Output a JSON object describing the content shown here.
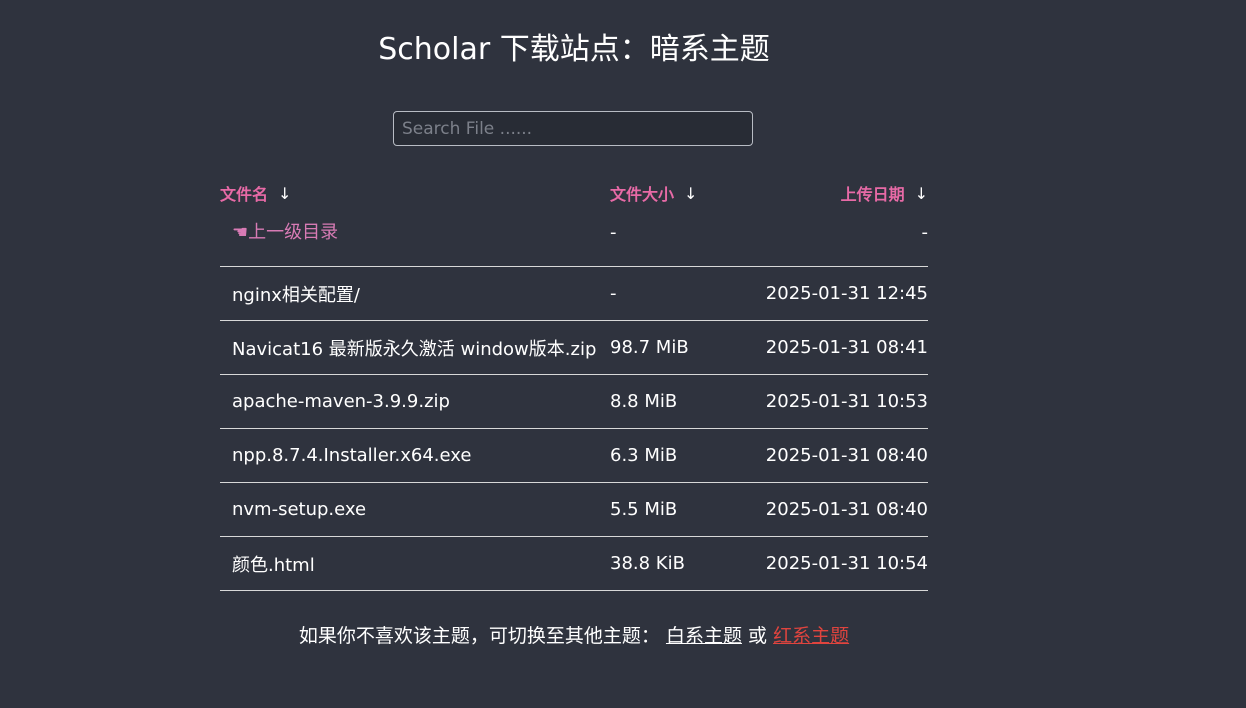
{
  "page": {
    "title": "Scholar 下载站点：暗系主题"
  },
  "search": {
    "placeholder": "Search File ......",
    "value": ""
  },
  "table": {
    "headers": {
      "name": "文件名",
      "size": "文件大小",
      "date": "上传日期",
      "sort_arrow": "↓"
    },
    "parent_row": {
      "name": "☚上一级目录",
      "size": "-",
      "date": "-"
    },
    "rows": [
      {
        "name": "nginx相关配置/",
        "size": "-",
        "date": "2025-01-31 12:45"
      },
      {
        "name": "Navicat16 最新版永久激活 window版本.zip",
        "size": "98.7 MiB",
        "date": "2025-01-31 08:41"
      },
      {
        "name": "apache-maven-3.9.9.zip",
        "size": "8.8 MiB",
        "date": "2025-01-31 10:53"
      },
      {
        "name": "npp.8.7.4.Installer.x64.exe",
        "size": "6.3 MiB",
        "date": "2025-01-31 08:40"
      },
      {
        "name": "nvm-setup.exe",
        "size": "5.5 MiB",
        "date": "2025-01-31 08:40"
      },
      {
        "name": "颜色.html",
        "size": "38.8 KiB",
        "date": "2025-01-31 10:54"
      }
    ]
  },
  "footer": {
    "text": "如果你不喜欢该主题，可切换至其他主题：",
    "white_theme_link": "白系主题",
    "or": "或",
    "red_theme_link": "红系主题"
  },
  "colors": {
    "background": "#2f333e",
    "accent_pink": "#e76aa6",
    "parent_link": "#d87bb5",
    "red_link": "#e0443e",
    "divider": "#d8d8d8"
  }
}
